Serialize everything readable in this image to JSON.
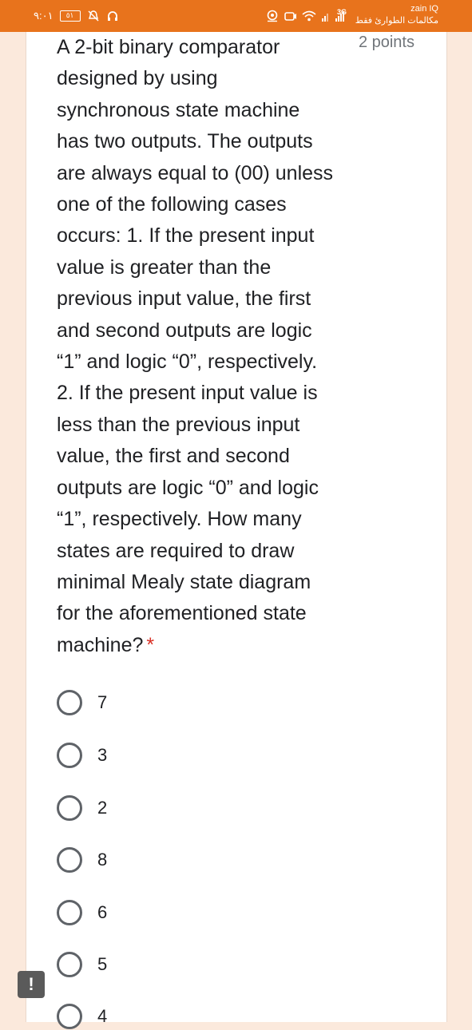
{
  "status_bar": {
    "time": "٩:٠١",
    "battery_level": "٥١",
    "network_type": "3G",
    "carrier": "zain IQ",
    "carrier_note": "مكالمات الطوارئ فقط",
    "icons": [
      "battery-icon",
      "no-alarm-icon",
      "headset-icon",
      "signal-icon",
      "wifi-icon",
      "camera-icon",
      "location-icon"
    ]
  },
  "question": {
    "text": "A 2-bit binary comparator\ndesigned by using\nsynchronous state machine\nhas two outputs. The outputs\nare always equal to (00) unless\none of the following cases\noccurs: 1. If the present input\nvalue is greater than the\nprevious input value, the first\nand second outputs are logic\n“1” and logic “0”, respectively.\n2. If the present input value is\nless than the previous input\nvalue, the first and second\noutputs are logic “0” and logic\n“1”, respectively. How many\nstates are required to draw\nminimal Mealy state diagram\nfor the aforementioned state\nmachine?",
    "required_marker": "*",
    "points": "2 points"
  },
  "options": [
    {
      "label": "7"
    },
    {
      "label": "3"
    },
    {
      "label": "2"
    },
    {
      "label": "8"
    },
    {
      "label": "6"
    },
    {
      "label": "5"
    },
    {
      "label": "4"
    }
  ],
  "alert_badge": "!",
  "colors": {
    "status_bar": "#e8731c",
    "page_background": "#fbe9dc",
    "required": "#d93025"
  }
}
